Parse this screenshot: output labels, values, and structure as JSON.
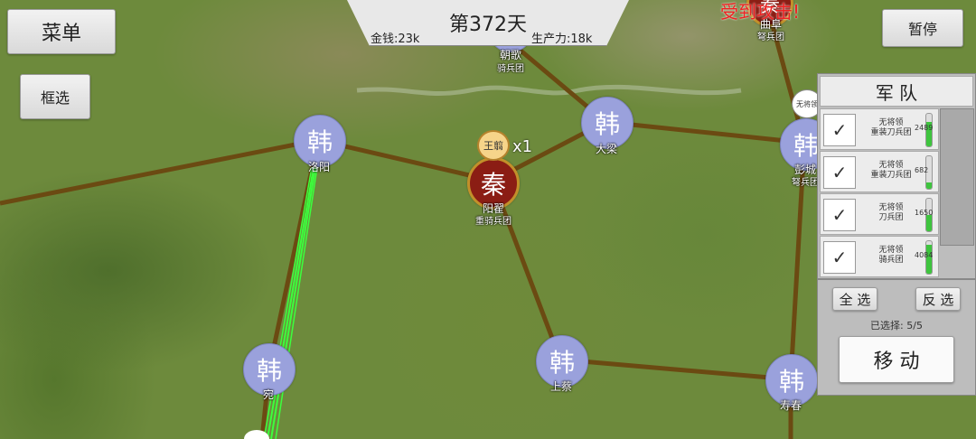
{
  "top": {
    "day": "第372天",
    "money": "金钱:23k",
    "production": "生产力:18k"
  },
  "buttons": {
    "menu": "菜单",
    "box_select": "框选",
    "pause": "暂停"
  },
  "alert": "受到攻击!",
  "cities": {
    "luoyang": {
      "glyph": "韩",
      "name": "洛阳"
    },
    "daliang": {
      "glyph": "韩",
      "name": "大梁"
    },
    "yangdi": {
      "glyph": "秦",
      "name": "阳翟",
      "unit": "重骑兵团"
    },
    "shangcai": {
      "glyph": "韩",
      "name": "上蔡"
    },
    "wan": {
      "glyph": "韩",
      "name": "宛"
    },
    "shouchun": {
      "glyph": "韩",
      "name": "寿春"
    },
    "pengcheng": {
      "glyph": "韩",
      "name": "彭城",
      "unit": "弩兵团"
    },
    "zhaoge": {
      "name": "朝歌",
      "unit": "骑兵团"
    },
    "qufu": {
      "glyph": "秦",
      "name": "曲阜",
      "unit": "弩兵团"
    }
  },
  "general": {
    "name": "王翦",
    "count": "x1"
  },
  "no_general_tag": "无将领",
  "army": {
    "title": "军 队",
    "rows": [
      {
        "checked": "✓",
        "line1": "无将领",
        "line2": "重装刀兵团",
        "count": "2489",
        "fill": 0.75
      },
      {
        "checked": "✓",
        "line1": "无将领",
        "line2": "重装刀兵团",
        "count": "682",
        "fill": 0.2
      },
      {
        "checked": "✓",
        "line1": "无将领",
        "line2": "刀兵团",
        "count": "1650",
        "fill": 0.5
      },
      {
        "checked": "✓",
        "line1": "无将领",
        "line2": "骑兵团",
        "count": "4084",
        "fill": 0.9
      }
    ],
    "select_all": "全 选",
    "invert": "反 选",
    "selected": "已选择:  5/5",
    "move": "移 动"
  }
}
